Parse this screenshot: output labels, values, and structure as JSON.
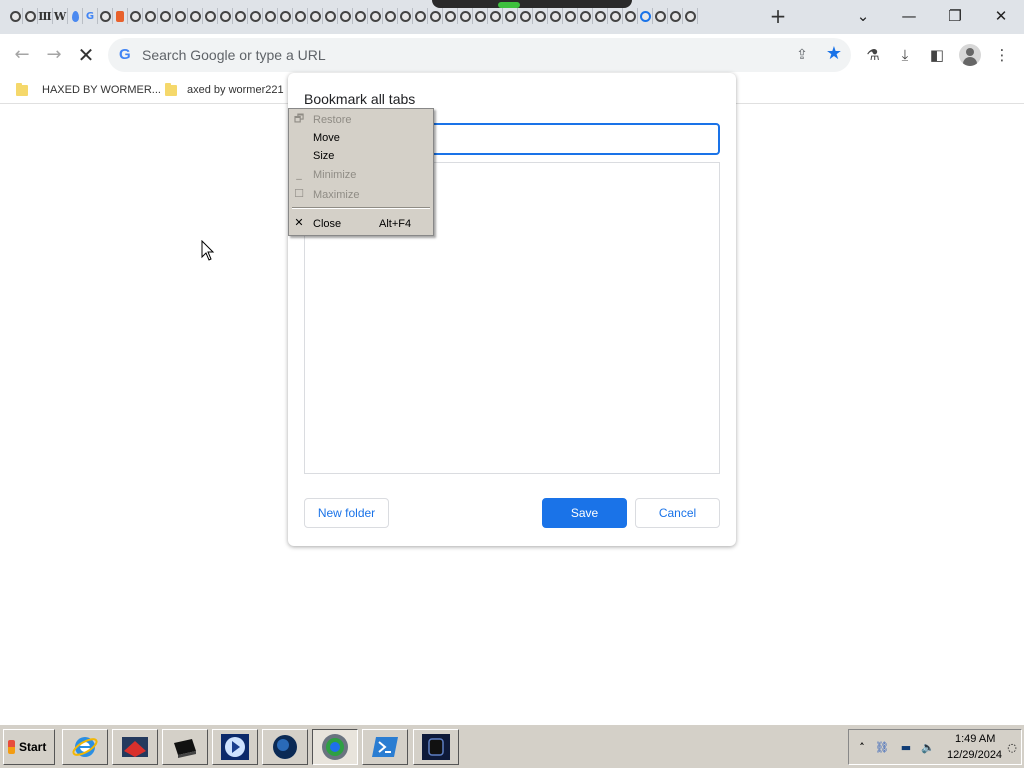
{
  "browser": {
    "tabstrip": {
      "new_tab_label": "+",
      "tab_list_icon": "chevron-down-icon",
      "window_controls": [
        "minimize",
        "restore",
        "close"
      ]
    },
    "toolbar": {
      "back_icon": "arrow-left-icon",
      "forward_icon": "arrow-right-icon",
      "stop_icon": "close-icon",
      "omnibox_placeholder": "Search Google or type a URL",
      "omnibox_g": "G"
    },
    "bookmarks_bar": [
      {
        "label": "HAXED BY WORMER..."
      },
      {
        "label": "axed by wormer221"
      }
    ]
  },
  "dialog": {
    "title": "Bookmark all tabs",
    "name_value": "",
    "new_folder_label": "New folder",
    "save_label": "Save",
    "cancel_label": "Cancel"
  },
  "system_menu": {
    "items": [
      {
        "label": "Restore",
        "shortcut": "",
        "enabled": false,
        "icon": "restore-icon"
      },
      {
        "label": "Move",
        "shortcut": "",
        "enabled": true,
        "icon": ""
      },
      {
        "label": "Size",
        "shortcut": "",
        "enabled": true,
        "icon": ""
      },
      {
        "label": "Minimize",
        "shortcut": "",
        "enabled": false,
        "icon": "minimize-icon"
      },
      {
        "label": "Maximize",
        "shortcut": "",
        "enabled": false,
        "icon": "maximize-icon"
      },
      {
        "label": "Close",
        "shortcut": "Alt+F4",
        "enabled": true,
        "icon": "close-icon"
      }
    ]
  },
  "taskbar": {
    "start_label": "Start",
    "buttons": [
      {
        "name": "internet-explorer"
      },
      {
        "name": "app-red"
      },
      {
        "name": "app-black"
      },
      {
        "name": "media-player"
      },
      {
        "name": "globe-app"
      },
      {
        "name": "chrome-app"
      },
      {
        "name": "powershell"
      },
      {
        "name": "app-dark"
      }
    ],
    "clock_time": "1:49 AM",
    "clock_date": "12/29/2024"
  },
  "colors": {
    "accent": "#1a73e8",
    "taskbar_bg": "#d4d0c8",
    "tabstrip_bg": "#dfe3e8"
  }
}
